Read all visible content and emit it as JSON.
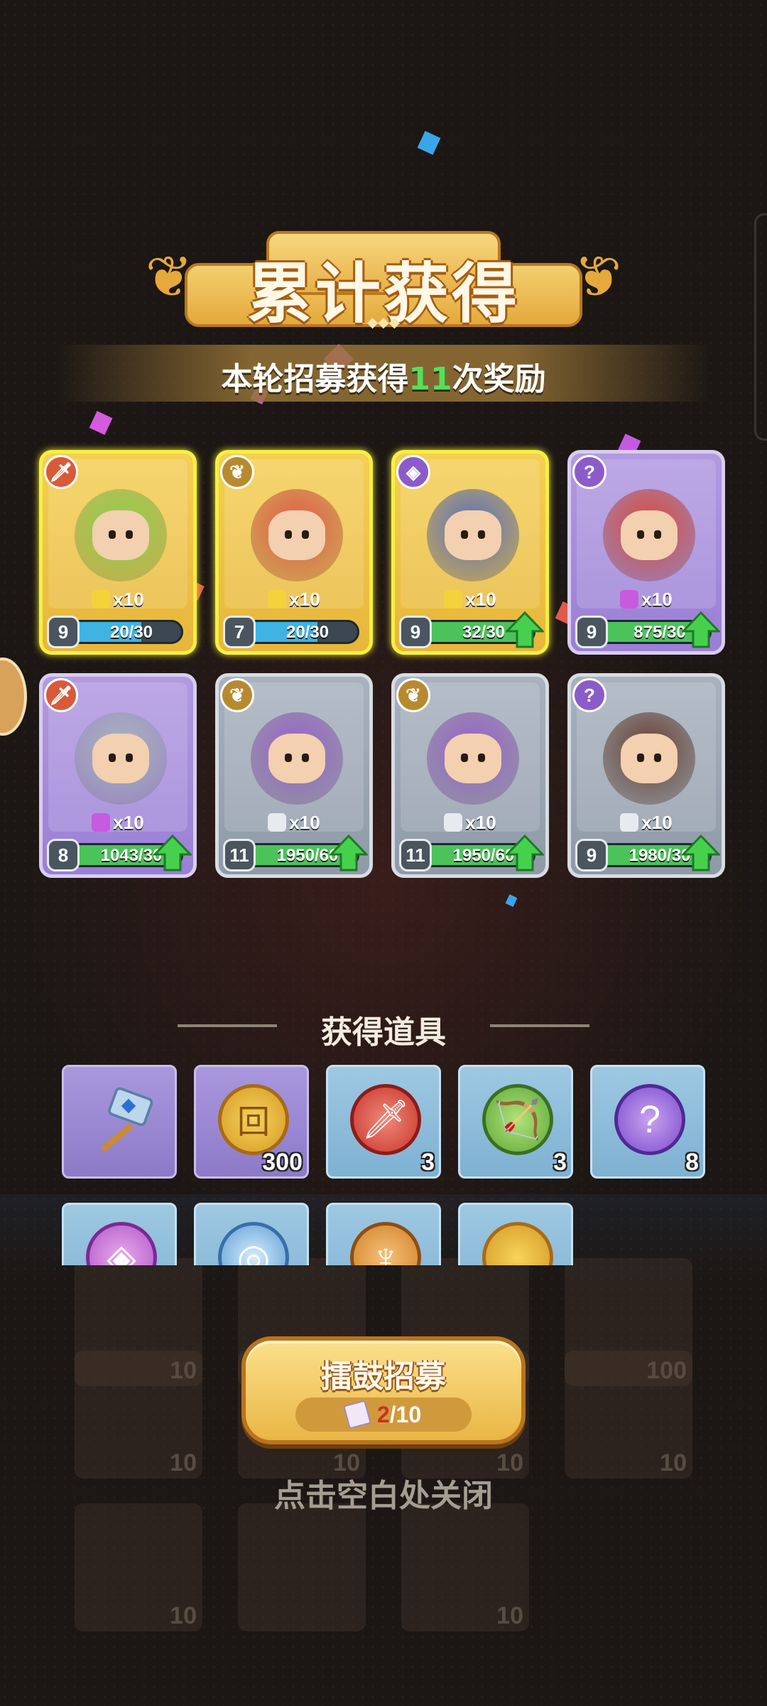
{
  "banner": {
    "title": "累计获得",
    "subtitle_prefix": "本轮招募获得",
    "subtitle_count": "11",
    "subtitle_suffix": "次奖励"
  },
  "heroes": [
    {
      "rarity": "gold",
      "class": "sword",
      "fragments": "x10",
      "level": "9",
      "progress": "20/30",
      "fill": 0.67,
      "upgrade": false
    },
    {
      "rarity": "gold",
      "class": "wings",
      "fragments": "x10",
      "level": "7",
      "progress": "20/30",
      "fill": 0.67,
      "upgrade": false
    },
    {
      "rarity": "gold",
      "class": "eye",
      "fragments": "x10",
      "level": "9",
      "progress": "32/30",
      "fill": 1.0,
      "upgrade": true
    },
    {
      "rarity": "purple",
      "class": "hook",
      "fragments": "x10",
      "level": "9",
      "progress": "875/30",
      "fill": 1.0,
      "upgrade": true
    },
    {
      "rarity": "purple",
      "class": "sword",
      "fragments": "x10",
      "level": "8",
      "progress": "1043/30",
      "fill": 1.0,
      "upgrade": true
    },
    {
      "rarity": "gray",
      "class": "wings",
      "fragments": "x10",
      "level": "11",
      "progress": "1950/60",
      "fill": 1.0,
      "upgrade": true
    },
    {
      "rarity": "gray",
      "class": "wings",
      "fragments": "x10",
      "level": "11",
      "progress": "1950/60",
      "fill": 1.0,
      "upgrade": true
    },
    {
      "rarity": "gray",
      "class": "hook",
      "fragments": "x10",
      "level": "9",
      "progress": "1980/30",
      "fill": 1.0,
      "upgrade": true
    }
  ],
  "items_section": {
    "title": "获得道具"
  },
  "items": [
    {
      "icon": "hammer-icon",
      "count": ""
    },
    {
      "icon": "gold-coin-icon",
      "count": "300"
    },
    {
      "icon": "sword-emblem-icon",
      "count": "3"
    },
    {
      "icon": "bow-emblem-icon",
      "count": "3"
    },
    {
      "icon": "hook-emblem-icon",
      "count": "8"
    }
  ],
  "items_row2": [
    {
      "icon": "eye-emblem-icon"
    },
    {
      "icon": "swirl-orb-icon"
    },
    {
      "icon": "wings-emblem-icon"
    },
    {
      "icon": "gold-coin-icon"
    }
  ],
  "recruit": {
    "label": "擂鼓招募",
    "current": "2",
    "total": "/10"
  },
  "close_hint": "点击空白处关闭",
  "colors": {
    "accent_gold": "#e7b63a",
    "highlight_green": "#54e05a",
    "cost_red": "#c8331d"
  }
}
